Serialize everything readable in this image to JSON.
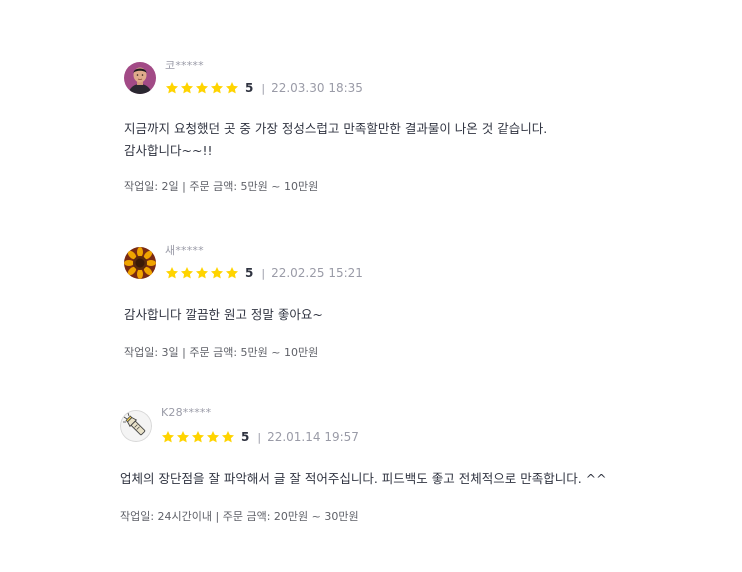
{
  "reviews": [
    {
      "avatar_icon": "person-avatar",
      "name": "코*****",
      "score": "5",
      "date": "22.03.30 18:35",
      "text": [
        "지금까지 요청했던 곳 중 가장 정성스럽고 만족할만한 결과물이 나온 것 같습니다.",
        "감사합니다~~!!"
      ],
      "meta": "작업일: 2일 | 주문 금액: 5만원 ~ 10만원"
    },
    {
      "avatar_icon": "sunflower-avatar",
      "name": "새*****",
      "score": "5",
      "date": "22.02.25 15:21",
      "text": [
        "감사합니다 깔끔한 원고 정말 좋아요~"
      ],
      "meta": "작업일: 3일 | 주문 금액: 5만원 ~ 10만원"
    },
    {
      "avatar_icon": "flashlight-avatar",
      "name": "K28*****",
      "score": "5",
      "date": "22.01.14 19:57",
      "text": [
        "업체의 장단점을 잘 파악해서 글 잘 적어주십니다. 피드백도 좋고 전체적으로 만족합니다. ^^"
      ],
      "meta": "작업일: 24시간이내 | 주문 금액: 20만원 ~ 30만원"
    }
  ],
  "colors": {
    "star": "#ffd400",
    "text": "#303441",
    "muted": "#9a9ba7"
  }
}
